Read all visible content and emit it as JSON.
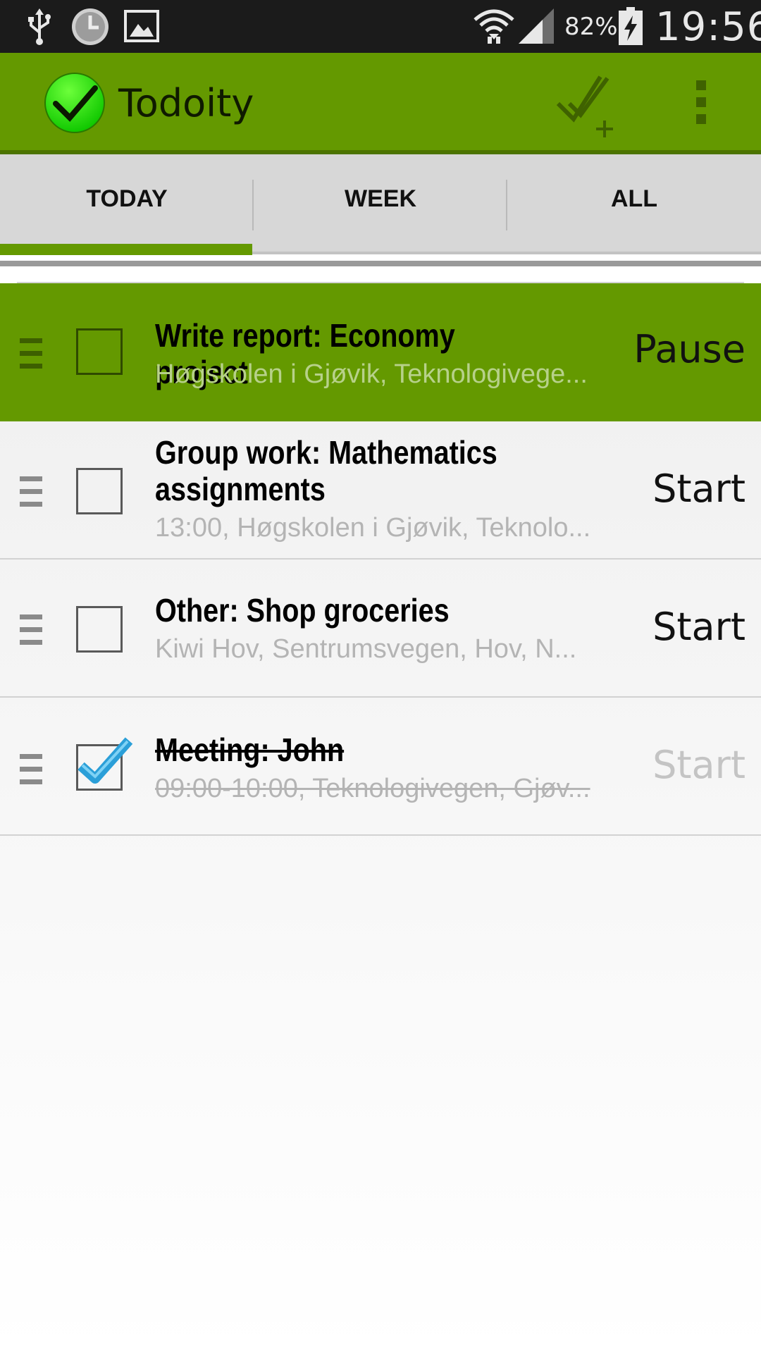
{
  "status_bar": {
    "icons": [
      "usb-icon",
      "clock-icon",
      "gallery-icon",
      "wifi-icon",
      "signal-icon",
      "battery-charging-icon"
    ],
    "battery": "82%",
    "time": "19:56"
  },
  "app_bar": {
    "title": "Todoity",
    "logo_icon": "green-checkmark-logo-icon",
    "actions": [
      "add-task-icon",
      "overflow-menu-icon"
    ]
  },
  "tabs": [
    {
      "label": "TODAY",
      "selected": true
    },
    {
      "label": "WEEK",
      "selected": false
    },
    {
      "label": "ALL",
      "selected": false
    }
  ],
  "tasks": [
    {
      "title": "Write report: Economy project",
      "subtitle": "Høgskolen i Gjøvik, Teknologivege...",
      "action": "Pause",
      "checked": false,
      "active": true
    },
    {
      "title": "Group work: Mathematics assignments",
      "subtitle": "13:00, Høgskolen i Gjøvik, Teknolo...",
      "action": "Start",
      "checked": false,
      "active": false
    },
    {
      "title": "Other: Shop groceries",
      "subtitle": "Kiwi Hov, Sentrumsvegen, Hov, N...",
      "action": "Start",
      "checked": false,
      "active": false
    },
    {
      "title": "Meeting: John",
      "subtitle": "09:00-10:00, Teknologivegen, Gjøv...",
      "action": "Start",
      "checked": true,
      "active": false
    }
  ],
  "colors": {
    "accent": "#649900",
    "status_bar": "#1b1b1b",
    "checkmark": "#2b9fd8"
  }
}
